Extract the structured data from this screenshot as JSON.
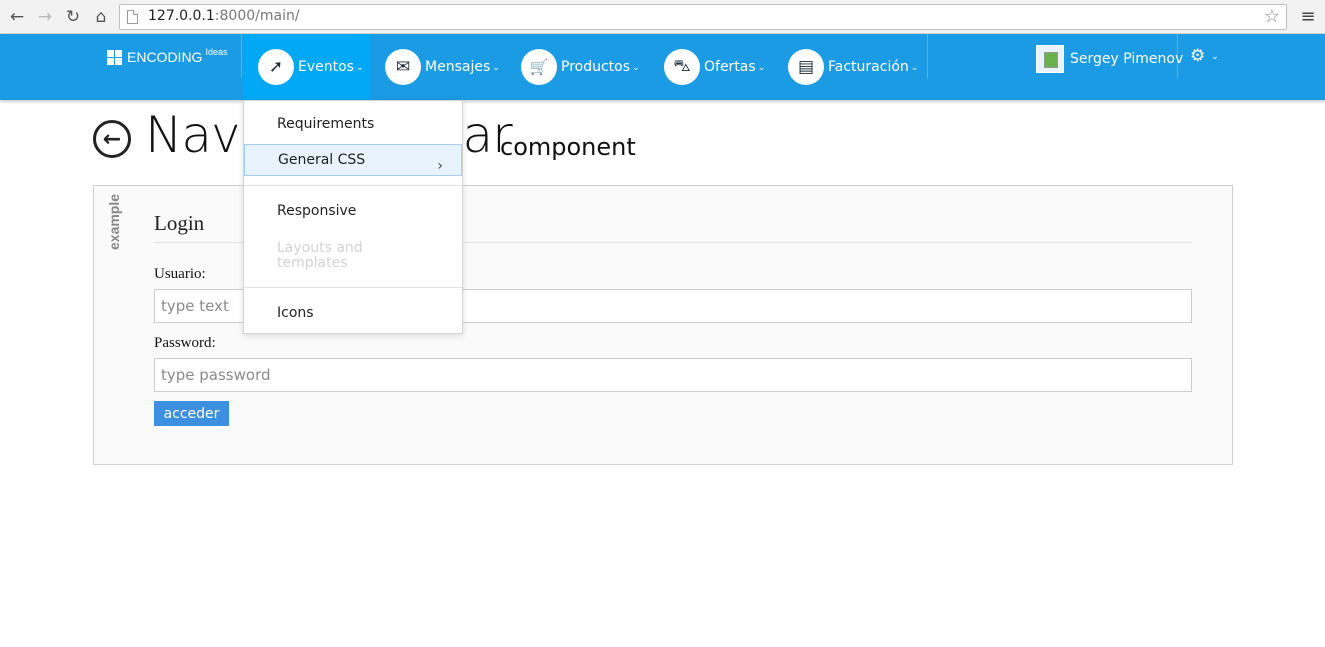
{
  "browser": {
    "url_host": "127.0.0.1",
    "url_rest": ":8000/main/",
    "back_glyph": "←",
    "forward_glyph": "→",
    "reload_glyph": "↻",
    "home_glyph": "⌂",
    "star_glyph": "☆",
    "menu_glyph": "≡"
  },
  "navbar": {
    "brand": "ENCODING",
    "brand_sup": "Ideas",
    "items": [
      {
        "label": "Eventos",
        "icon": "rocket-icon",
        "glyph": "➚",
        "active": true
      },
      {
        "label": "Mensajes",
        "icon": "envelope-icon",
        "glyph": "✉",
        "active": false
      },
      {
        "label": "Productos",
        "icon": "cart-icon",
        "glyph": "🛒",
        "active": false
      },
      {
        "label": "Ofertas",
        "icon": "basket-icon",
        "glyph": "⛍",
        "active": false
      },
      {
        "label": "Facturación",
        "icon": "money-icon",
        "glyph": "▤",
        "active": false
      }
    ],
    "caret": "⌄",
    "user_name": "Sergey Pimenov",
    "gear_glyph": "⚙",
    "accent_color": "#1b9be3"
  },
  "page": {
    "back_glyph": "←",
    "title": "Navi",
    "title_tail": "ar",
    "subtitle": "component"
  },
  "panel": {
    "tag": "example",
    "login_title": "Login",
    "user_label": "Usuario:",
    "user_placeholder": "type text",
    "password_label": "Password:",
    "password_placeholder": "type password",
    "submit_label": "acceder"
  },
  "dropdown": {
    "items": [
      {
        "label": "Requirements"
      },
      {
        "label": "General CSS",
        "arrow": "›"
      },
      {
        "label": "Responsive"
      },
      {
        "label": "Layouts and templates",
        "disabled": true
      },
      {
        "label": "Icons"
      }
    ]
  }
}
